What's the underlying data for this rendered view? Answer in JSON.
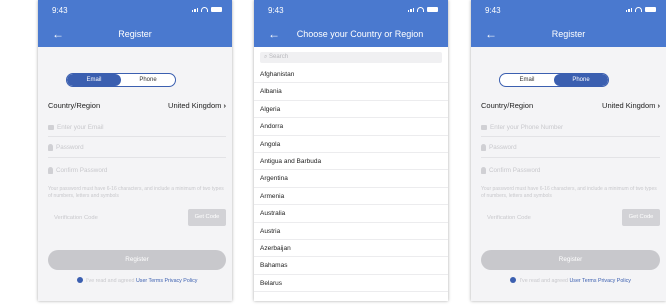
{
  "status": {
    "time": "9:43"
  },
  "register": {
    "title": "Register",
    "back": "←",
    "toggle": {
      "email": "Email",
      "phone": "Phone"
    },
    "country_label": "Country/Region",
    "country_value": "United Kingdom",
    "email_placeholder": "Enter your Email",
    "phone_placeholder": "Enter your Phone Number",
    "password_placeholder": "Password",
    "confirm_placeholder": "Confirm Password",
    "password_note": "Your password must have 6-16 characters, and include a minimum of two types of numbers, letters and symbols",
    "verification_placeholder": "Verification Code",
    "get_code": "Get Code",
    "register_button": "Register",
    "agree_text": "I've read and agreed",
    "terms_link": "User Terms",
    "privacy_link": "Privacy Policy"
  },
  "country_select": {
    "title": "Choose your Country or Region",
    "back": "←",
    "search_placeholder": "Search",
    "countries": [
      "Afghanistan",
      "Albania",
      "Algeria",
      "Andorra",
      "Angola",
      "Antigua and Barbuda",
      "Argentina",
      "Armenia",
      "Australia",
      "Austria",
      "Azerbaijan",
      "Bahamas",
      "Belarus"
    ]
  },
  "colors": {
    "header": "#4a79cf",
    "accent": "#3b5fb0",
    "disabled": "#c8c8cc"
  }
}
